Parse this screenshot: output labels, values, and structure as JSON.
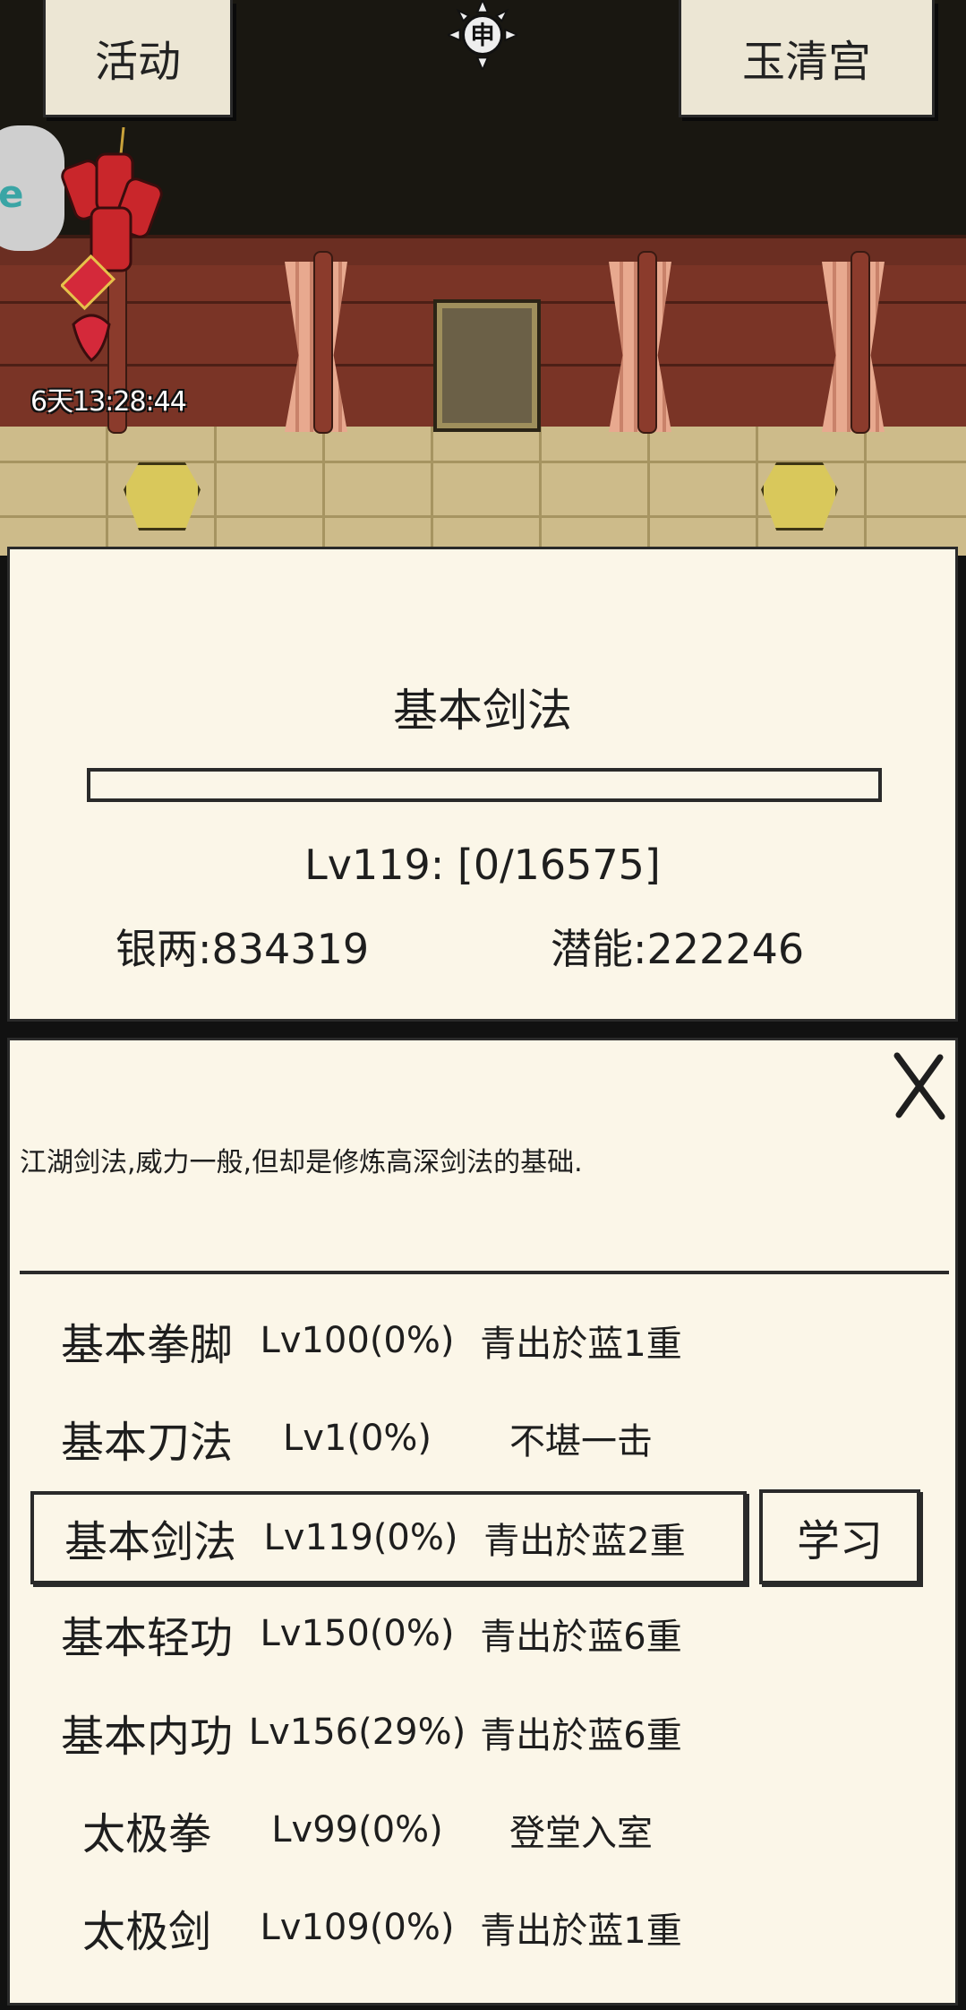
{
  "header": {
    "activity_label": "活动",
    "location_label": "玉清宫",
    "event_timer": "6天13:28:44",
    "emblem_char": "申"
  },
  "skill_detail": {
    "name": "基本剑法",
    "progress_fraction": 0,
    "level_text": "Lv119: [0/16575]",
    "silver_text": "银两:834319",
    "potential_text": "潜能:222246"
  },
  "skill_panel": {
    "close_icon": "close-icon",
    "description": "江湖剑法,威力一般,但却是修炼高深剑法的基础.",
    "learn_label": "学习",
    "skills": [
      {
        "name": "基本拳脚",
        "level": "Lv100(0%)",
        "rank": "青出於蓝1重"
      },
      {
        "name": "基本刀法",
        "level": "Lv1(0%)",
        "rank": "不堪一击"
      },
      {
        "name": "基本剑法",
        "level": "Lv119(0%)",
        "rank": "青出於蓝2重",
        "selected": true
      },
      {
        "name": "基本轻功",
        "level": "Lv150(0%)",
        "rank": "青出於蓝6重"
      },
      {
        "name": "基本内功",
        "level": "Lv156(29%)",
        "rank": "青出於蓝6重"
      },
      {
        "name": "太极拳",
        "level": "Lv99(0%)",
        "rank": "登堂入室"
      },
      {
        "name": "太极剑",
        "level": "Lv109(0%)",
        "rank": "青出於蓝1重"
      }
    ]
  }
}
